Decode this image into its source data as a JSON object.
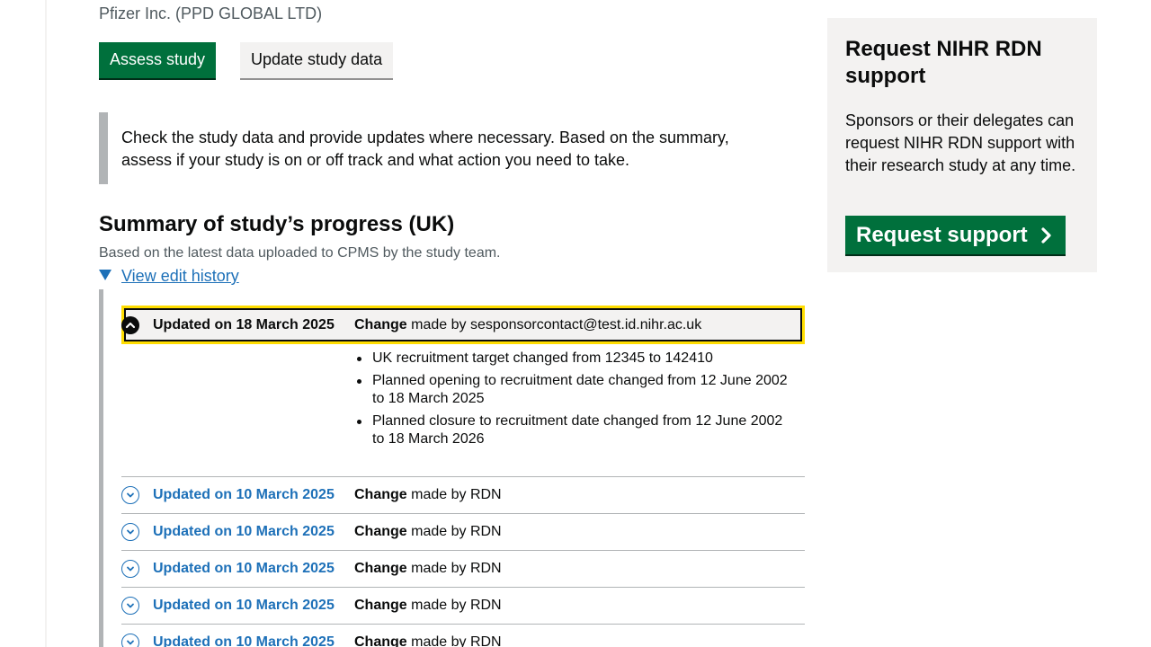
{
  "sponsor": "Pfizer Inc. (PPD GLOBAL LTD)",
  "buttons": {
    "assess": "Assess study",
    "update": "Update study data"
  },
  "inset_text": "Check the study data and provide updates where necessary. Based on the summary, assess if your study is on or off track and what action you need to take.",
  "summary": {
    "title": "Summary of study’s progress (UK)",
    "subtitle": "Based on the latest data uploaded to CPMS by the study team.",
    "history_link": "View edit history"
  },
  "history": {
    "expanded": {
      "date": "Updated on 18 March 2025",
      "change_label": "Change",
      "made_by": "made by sesponsorcontact@test.id.nihr.ac.uk",
      "changes": [
        "UK recruitment target changed from 12345 to 142410",
        "Planned opening to recruitment date changed from 12 June 2002 to 18 March 2025",
        "Planned closure to recruitment date changed from 12 June 2002 to 18 March 2026"
      ]
    },
    "collapsed": [
      {
        "date": "Updated on 10 March 2025",
        "change_label": "Change",
        "made_by": "made by RDN"
      },
      {
        "date": "Updated on 10 March 2025",
        "change_label": "Change",
        "made_by": "made by RDN"
      },
      {
        "date": "Updated on 10 March 2025",
        "change_label": "Change",
        "made_by": "made by RDN"
      },
      {
        "date": "Updated on 10 March 2025",
        "change_label": "Change",
        "made_by": "made by RDN"
      },
      {
        "date": "Updated on 10 March 2025",
        "change_label": "Change",
        "made_by": "made by RDN"
      }
    ]
  },
  "sidebar": {
    "title": "Request NIHR RDN support",
    "text": "Sponsors or their delegates can request NIHR RDN support with their research study at any time.",
    "button": "Request support"
  },
  "colors": {
    "primary_green": "#00703c",
    "link_blue": "#1d70b8",
    "focus_yellow": "#ffdd00",
    "panel_grey": "#f3f2f1"
  },
  "icons": {
    "expanded": "chevron-up-icon",
    "collapsed": "chevron-down-icon",
    "details_marker": "triangle-down-icon",
    "button_arrow": "chevron-right-icon"
  }
}
